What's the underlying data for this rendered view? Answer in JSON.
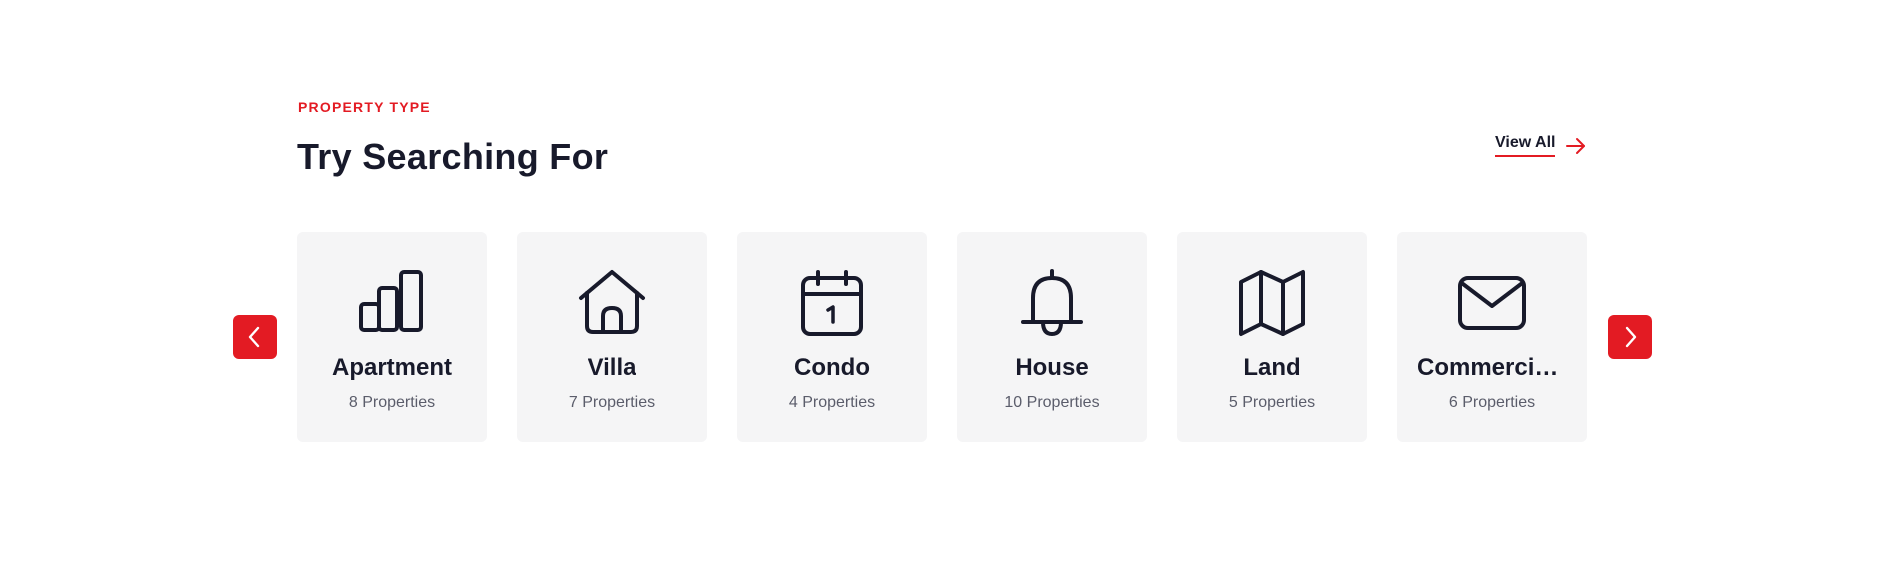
{
  "header": {
    "eyebrow": "PROPERTY TYPE",
    "title": "Try Searching For",
    "view_all_label": "View All"
  },
  "colors": {
    "accent": "#e31b23",
    "text": "#181a2b",
    "card_bg": "#f5f5f6",
    "muted": "#5b5d6b"
  },
  "carousel": {
    "prev_icon": "chevron-left-icon",
    "next_icon": "chevron-right-icon"
  },
  "property_types": [
    {
      "name": "Apartment",
      "count": "8 Properties",
      "icon": "bar-chart-icon"
    },
    {
      "name": "Villa",
      "count": "7 Properties",
      "icon": "house-icon"
    },
    {
      "name": "Condo",
      "count": "4 Properties",
      "icon": "calendar-icon"
    },
    {
      "name": "House",
      "count": "10 Properties",
      "icon": "bell-icon"
    },
    {
      "name": "Land",
      "count": "5 Properties",
      "icon": "map-icon"
    },
    {
      "name": "Commercia...",
      "count": "6 Properties",
      "icon": "envelope-icon"
    }
  ]
}
